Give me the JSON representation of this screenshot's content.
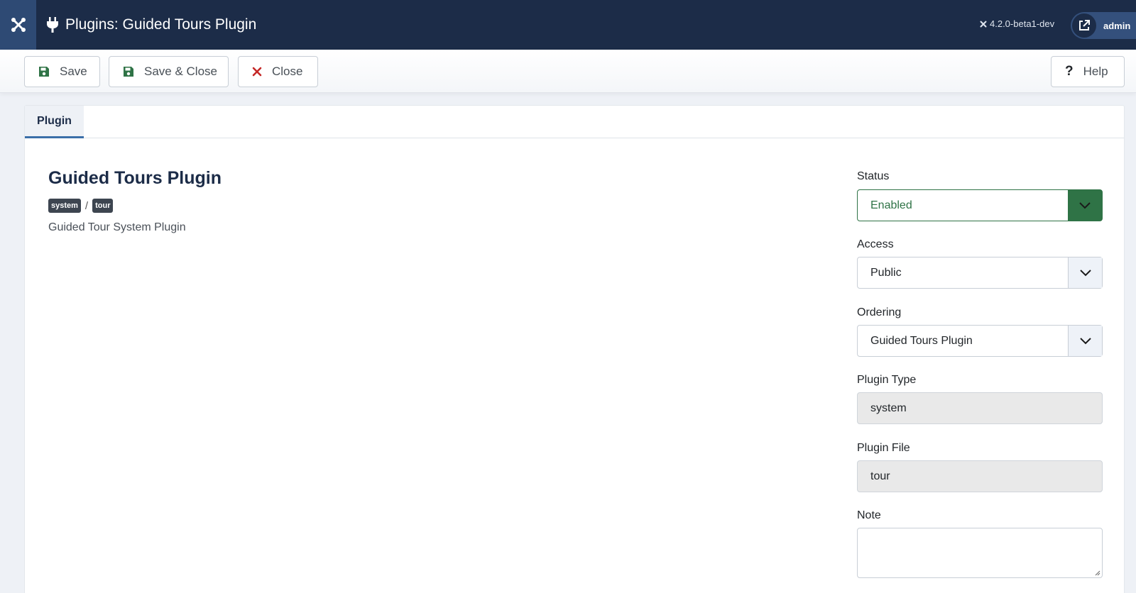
{
  "header": {
    "title": "Plugins: Guided Tours Plugin",
    "version": "4.2.0-beta1-dev",
    "user": "admin",
    "bg_color": "#1c2c48"
  },
  "toolbar": {
    "save_label": "Save",
    "save_close_label": "Save & Close",
    "close_label": "Close",
    "help_label": "Help"
  },
  "tabs": [
    {
      "label": "Plugin",
      "active": true
    }
  ],
  "plugin": {
    "title": "Guided Tours Plugin",
    "folder_badge": "system",
    "element_badge": "tour",
    "separator": "/",
    "description": "Guided Tour System Plugin"
  },
  "form": {
    "status": {
      "label": "Status",
      "value": "Enabled",
      "color": "#2f7346"
    },
    "access": {
      "label": "Access",
      "value": "Public"
    },
    "ordering": {
      "label": "Ordering",
      "value": "Guided Tours Plugin"
    },
    "plugin_type": {
      "label": "Plugin Type",
      "value": "system"
    },
    "plugin_file": {
      "label": "Plugin File",
      "value": "tour"
    },
    "note": {
      "label": "Note",
      "value": ""
    }
  }
}
